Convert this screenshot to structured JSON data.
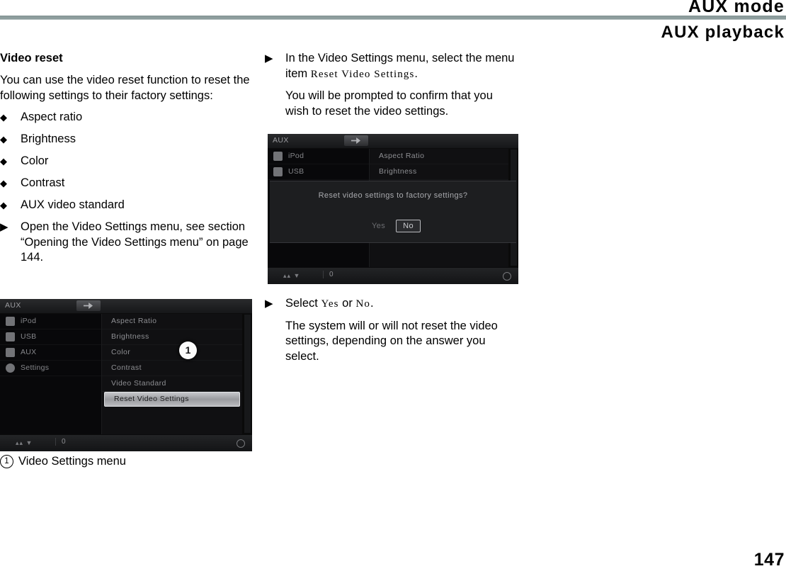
{
  "header": {
    "title": "AUX mode",
    "subtitle": "AUX playback"
  },
  "left_column": {
    "section_title": "Video reset",
    "intro": "You can use the video reset function to reset the following settings to their factory settings:",
    "bullet_glyph": "◆",
    "step_glyph": "▶",
    "bullets": [
      "Aspect ratio",
      "Brightness",
      "Color",
      "Contrast",
      "AUX video standard"
    ],
    "step": "Open the Video Settings menu, see section “Opening the Video Settings menu” on page 144."
  },
  "right_column": {
    "step_glyph": "▶",
    "step1_prefix": "In the Video Settings menu, select the menu item ",
    "step1_term": "Reset Video Settings",
    "step1_suffix": ".",
    "step1_note": "You will be prompted to confirm that you wish to reset the video settings.",
    "step2_prefix": "Select ",
    "step2_term_yes": "Yes",
    "step2_or": " or ",
    "step2_term_no": "No",
    "step2_suffix": ".",
    "step2_note": "The system will or will not reset the video settings, depending on the answer you select."
  },
  "screenshot_left": {
    "titlebar": "AUX",
    "sidebar_items": [
      {
        "label": "iPod",
        "icon": "ipod-icon"
      },
      {
        "label": "USB",
        "icon": "usb-icon"
      },
      {
        "label": "AUX",
        "icon": "aux-icon"
      },
      {
        "label": "Settings",
        "icon": "gear-icon"
      }
    ],
    "menu_items": [
      {
        "label": "Aspect Ratio",
        "selected": false
      },
      {
        "label": "Brightness",
        "selected": false
      },
      {
        "label": "Color",
        "selected": false
      },
      {
        "label": "Contrast",
        "selected": false
      },
      {
        "label": "Video Standard",
        "selected": false
      },
      {
        "label": "Reset Video Settings",
        "selected": true
      }
    ],
    "status_left": "▴▴ ▼",
    "status_mid": "0",
    "callout": "1"
  },
  "screenshot_right": {
    "titlebar": "AUX",
    "sidebar_items": [
      {
        "label": "iPod",
        "icon": "ipod-icon"
      },
      {
        "label": "USB",
        "icon": "usb-icon"
      }
    ],
    "menu_items": [
      {
        "label": "Aspect Ratio"
      },
      {
        "label": "Brightness"
      }
    ],
    "dialog": {
      "message": "Reset video settings to factory settings?",
      "yes_label": "Yes",
      "no_label": "No"
    },
    "status_left": "▴▴ ▼",
    "status_mid": "0"
  },
  "caption": {
    "number": "1",
    "text": "Video Settings menu"
  },
  "footer": {
    "page_number": "147"
  },
  "colors": {
    "rule": "#8d9d9d",
    "device_bg": "#0a0a0a",
    "highlight": "#c6c7cb"
  }
}
